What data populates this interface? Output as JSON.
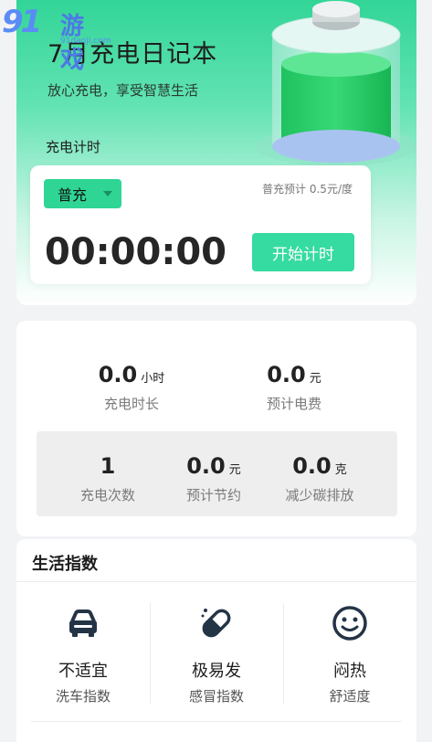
{
  "watermark": {
    "num": "91",
    "text": "游戏",
    "url": "91danji.com"
  },
  "hero": {
    "title": "7月充电日记本",
    "subtitle": "放心充电，享受智慧生活",
    "section_label": "充电计时"
  },
  "timer": {
    "mode": "普充",
    "rate": "普充预计 0.5元/度",
    "clock": "00:00:00",
    "start_label": "开始计时"
  },
  "stats": {
    "duration": {
      "value": "0.0",
      "unit": "小时",
      "label": "充电时长"
    },
    "cost": {
      "value": "0.0",
      "unit": "元",
      "label": "预计电费"
    },
    "count": {
      "value": "1",
      "label": "充电次数"
    },
    "saving": {
      "value": "0.0",
      "unit": "元",
      "label": "预计节约"
    },
    "carbon": {
      "value": "0.0",
      "unit": "克",
      "label": "减少碳排放"
    }
  },
  "life": {
    "title": "生活指数",
    "items": [
      {
        "icon": "car-icon",
        "value": "不适宜",
        "label": "洗车指数"
      },
      {
        "icon": "pill-icon",
        "value": "极易发",
        "label": "感冒指数"
      },
      {
        "icon": "smiley-icon",
        "value": "闷热",
        "label": "舒适度"
      }
    ]
  },
  "colors": {
    "accent": "#35dba0",
    "brand_green": "#2fd594",
    "watermark_blue": "#4d79e6"
  }
}
